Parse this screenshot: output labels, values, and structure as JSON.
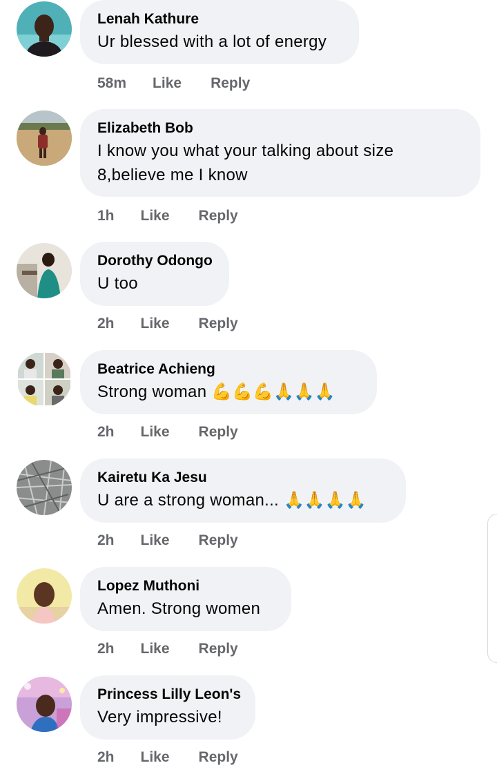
{
  "comments": [
    {
      "author": "Lenah Kathure",
      "text": "Ur blessed with a lot of energy",
      "time": "58m",
      "like": "Like",
      "reply": "Reply",
      "avatar": "avatar-lenah"
    },
    {
      "author": "Elizabeth Bob",
      "text": "I know you what your talking about size 8,believe me I know",
      "time": "1h",
      "like": "Like",
      "reply": "Reply",
      "avatar": "avatar-elizabeth"
    },
    {
      "author": "Dorothy Odongo",
      "text": "U too",
      "time": "2h",
      "like": "Like",
      "reply": "Reply",
      "avatar": "avatar-dorothy"
    },
    {
      "author": "Beatrice Achieng",
      "text": "Strong woman",
      "emoji": "💪💪💪🙏🙏🙏",
      "time": "2h",
      "like": "Like",
      "reply": "Reply",
      "avatar": "avatar-beatrice"
    },
    {
      "author": "Kairetu Ka Jesu",
      "text": "U are a strong woman...",
      "emoji": "🙏🙏🙏🙏",
      "time": "2h",
      "like": "Like",
      "reply": "Reply",
      "avatar": "avatar-kairetu"
    },
    {
      "author": "Lopez Muthoni",
      "text": "Amen.  Strong women",
      "time": "2h",
      "like": "Like",
      "reply": "Reply",
      "avatar": "avatar-lopez"
    },
    {
      "author": "Princess Lilly Leon's",
      "text": "Very impressive!",
      "time": "2h",
      "like": "Like",
      "reply": "Reply",
      "avatar": "avatar-princess"
    }
  ]
}
